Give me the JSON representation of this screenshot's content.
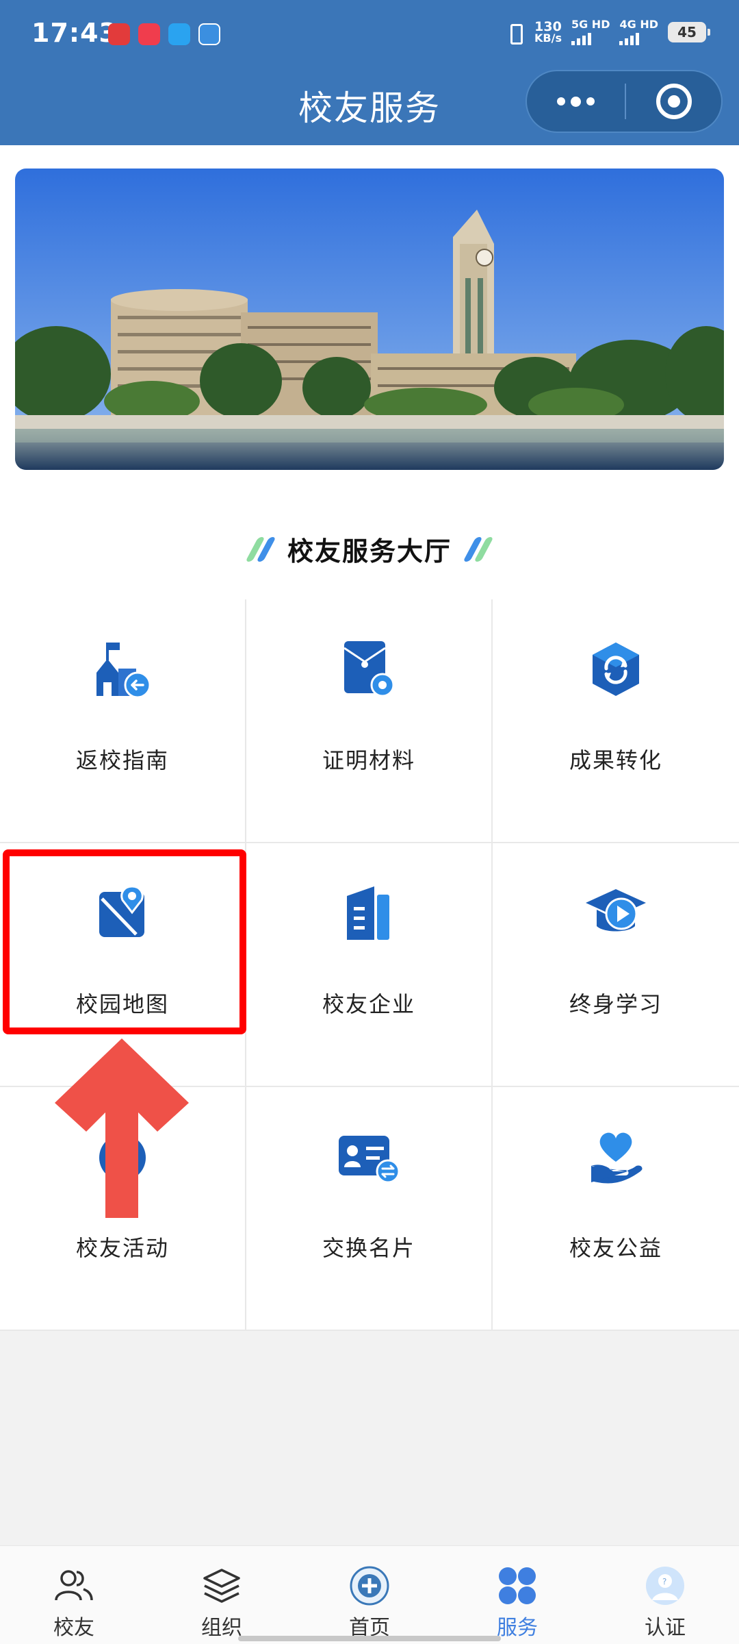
{
  "status_bar": {
    "time": "17:43",
    "net_speed": "130",
    "net_unit": "KB/s",
    "sim1": "5G HD",
    "sim2": "4G HD",
    "battery": "45"
  },
  "header": {
    "title": "校友服务"
  },
  "section": {
    "title": "校友服务大厅"
  },
  "services": [
    {
      "label": "返校指南",
      "icon": "school-return-icon"
    },
    {
      "label": "证明材料",
      "icon": "document-settings-icon"
    },
    {
      "label": "成果转化",
      "icon": "conversion-cube-icon"
    },
    {
      "label": "校园地图",
      "icon": "map-pin-icon"
    },
    {
      "label": "校友企业",
      "icon": "building-icon"
    },
    {
      "label": "终身学习",
      "icon": "graduation-play-icon"
    },
    {
      "label": "校友活动",
      "icon": "activity-icon"
    },
    {
      "label": "交换名片",
      "icon": "business-card-exchange-icon"
    },
    {
      "label": "校友公益",
      "icon": "charity-heart-hand-icon"
    }
  ],
  "bottom_nav": [
    {
      "label": "校友",
      "icon": "people-icon",
      "active": false
    },
    {
      "label": "组织",
      "icon": "layers-icon",
      "active": false
    },
    {
      "label": "首页",
      "icon": "university-emblem-icon",
      "active": false
    },
    {
      "label": "服务",
      "icon": "grid-flower-icon",
      "active": true
    },
    {
      "label": "认证",
      "icon": "avatar-question-icon",
      "active": false
    }
  ],
  "colors": {
    "header_bg": "#3b76b8",
    "icon_blue": "#1d5fb8",
    "icon_accent": "#2f8ee8",
    "active_tab": "#3f7fe0",
    "highlight": "#ff0000",
    "arrow": "#ef5148"
  }
}
